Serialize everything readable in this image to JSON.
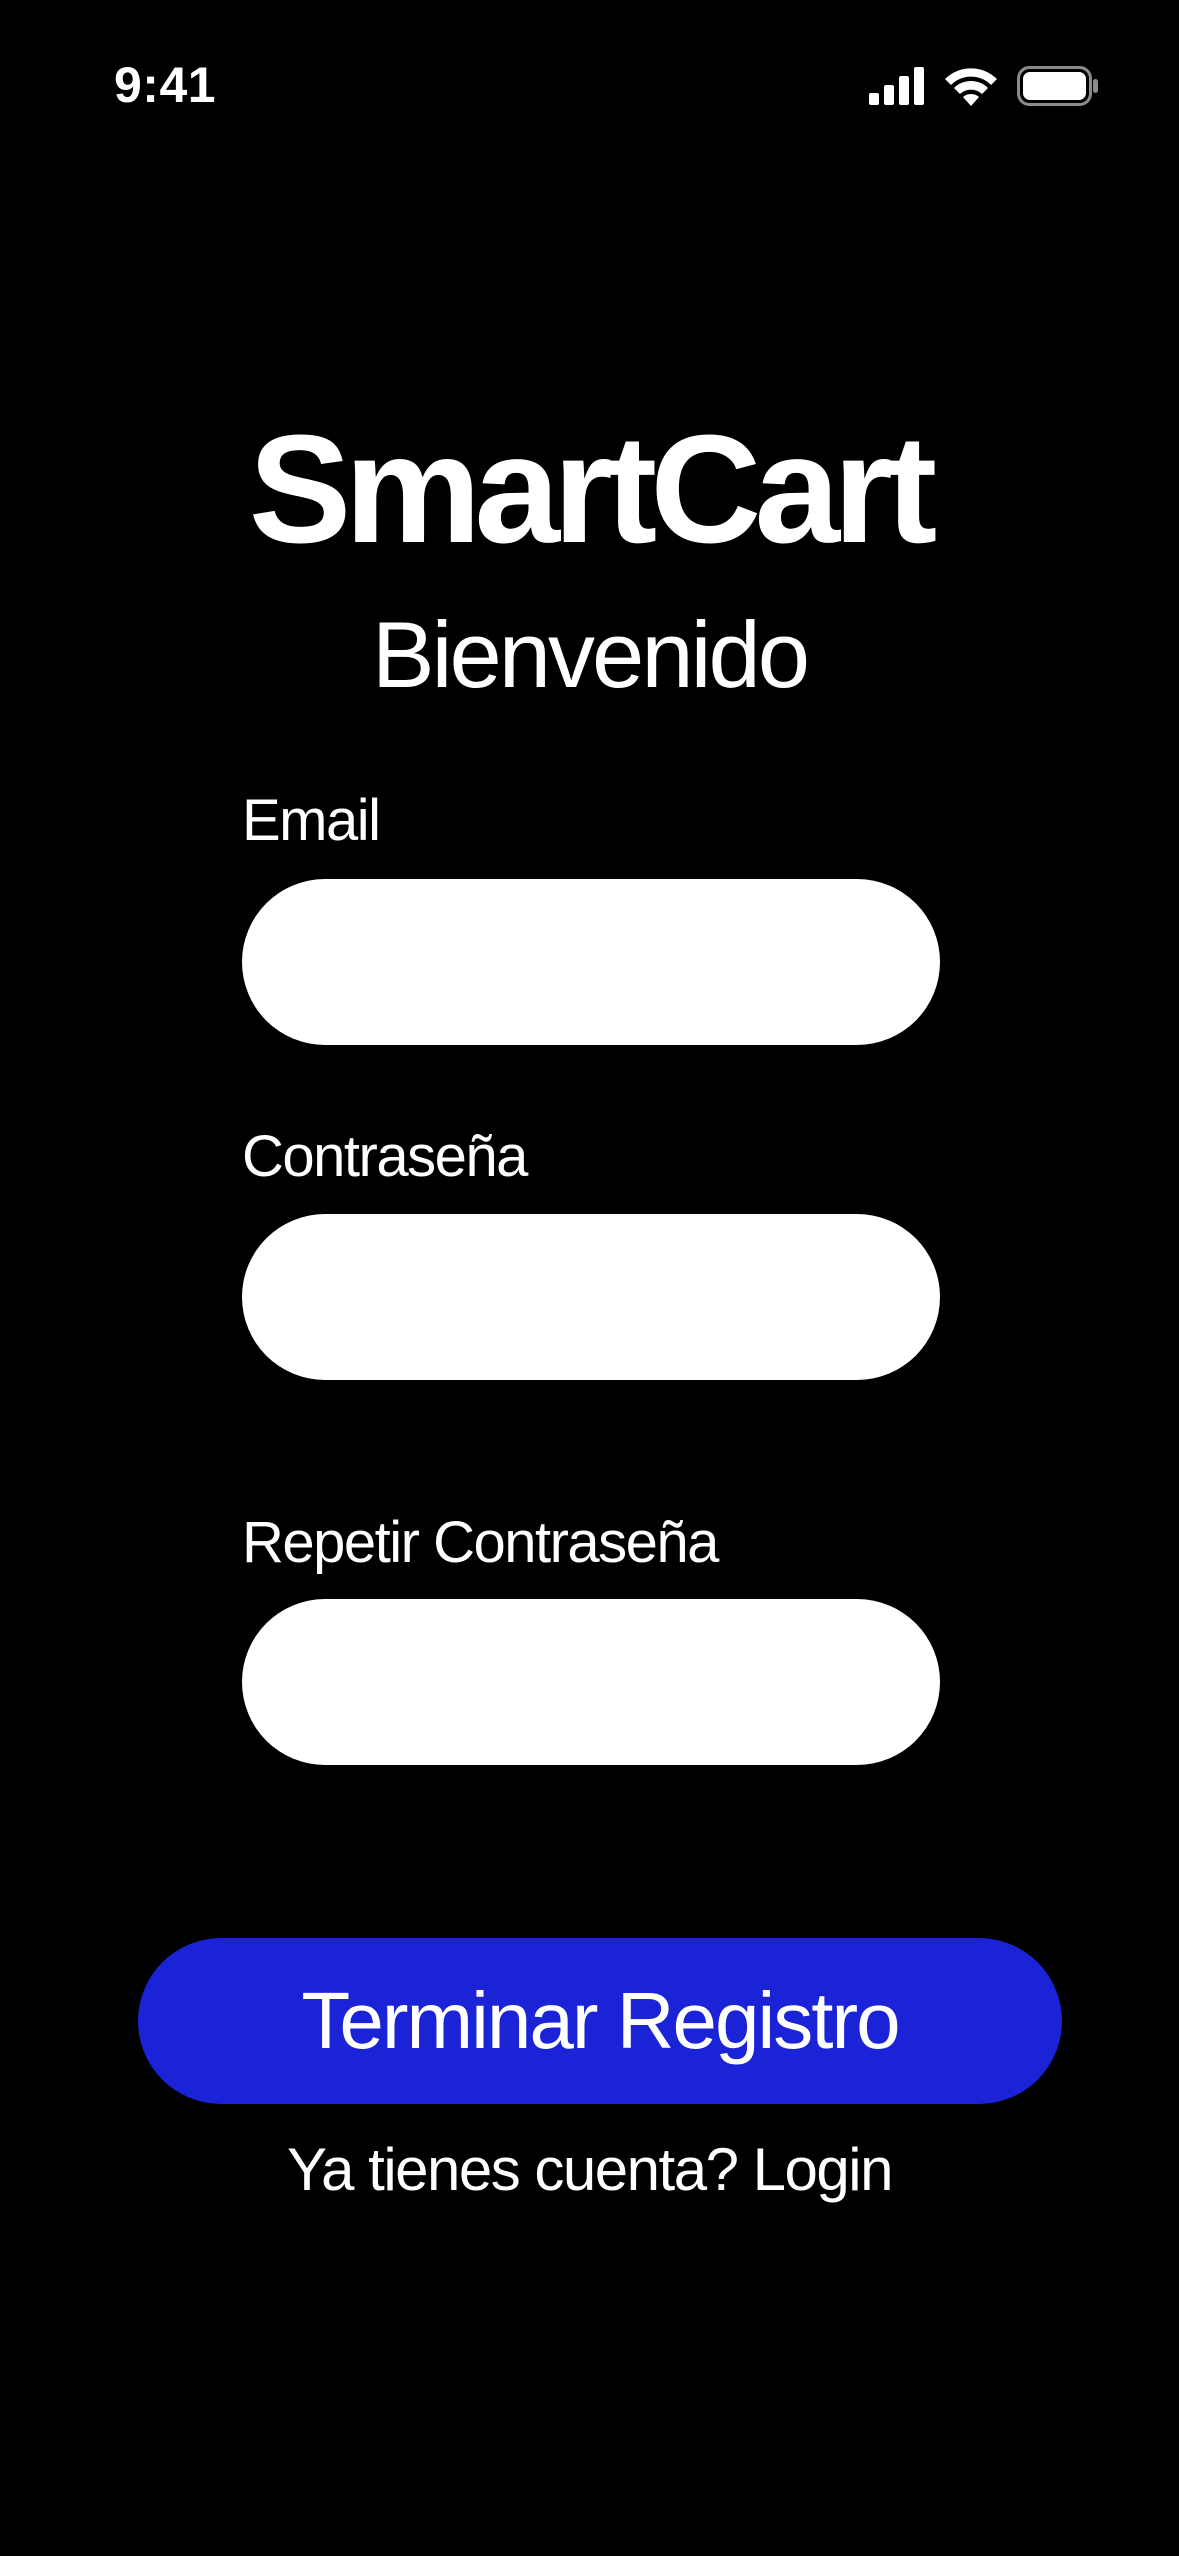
{
  "status_bar": {
    "time": "9:41",
    "icons": [
      "signal-icon",
      "wifi-icon",
      "battery-icon"
    ]
  },
  "app": {
    "brand": "SmartCart",
    "welcome": "Bienvenido"
  },
  "form": {
    "email_label": "Email",
    "email_value": "",
    "password_label": "Contraseña",
    "password_value": "",
    "repeat_password_label": "Repetir Contraseña",
    "repeat_password_value": "",
    "submit_label": "Terminar Registro"
  },
  "footer": {
    "prompt": "Ya tienes cuenta?",
    "login_label": "Login"
  },
  "colors": {
    "background": "#000000",
    "text": "#ffffff",
    "input_background": "#ffffff",
    "accent": "#1a23d6"
  }
}
